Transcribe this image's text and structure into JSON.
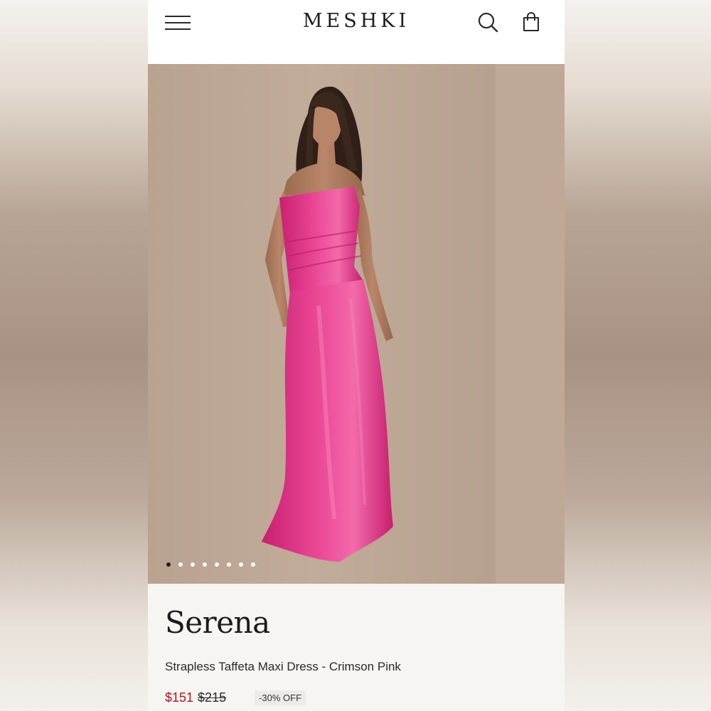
{
  "header": {
    "brand": "MESHKI",
    "menu_icon": "hamburger-menu-icon",
    "search_icon": "search-icon",
    "bag_icon": "shopping-bag-icon"
  },
  "gallery": {
    "image_count": 8,
    "active_index": 0
  },
  "product": {
    "name": "Serena",
    "subtitle": "Strapless Taffeta Maxi Dress - Crimson Pink",
    "price_now": "$151",
    "price_was": "$215",
    "discount": "-30% OFF"
  },
  "colors": {
    "sale_red": "#b4141e",
    "dress_pink": "#e23a8c",
    "backdrop": "#bda692"
  }
}
